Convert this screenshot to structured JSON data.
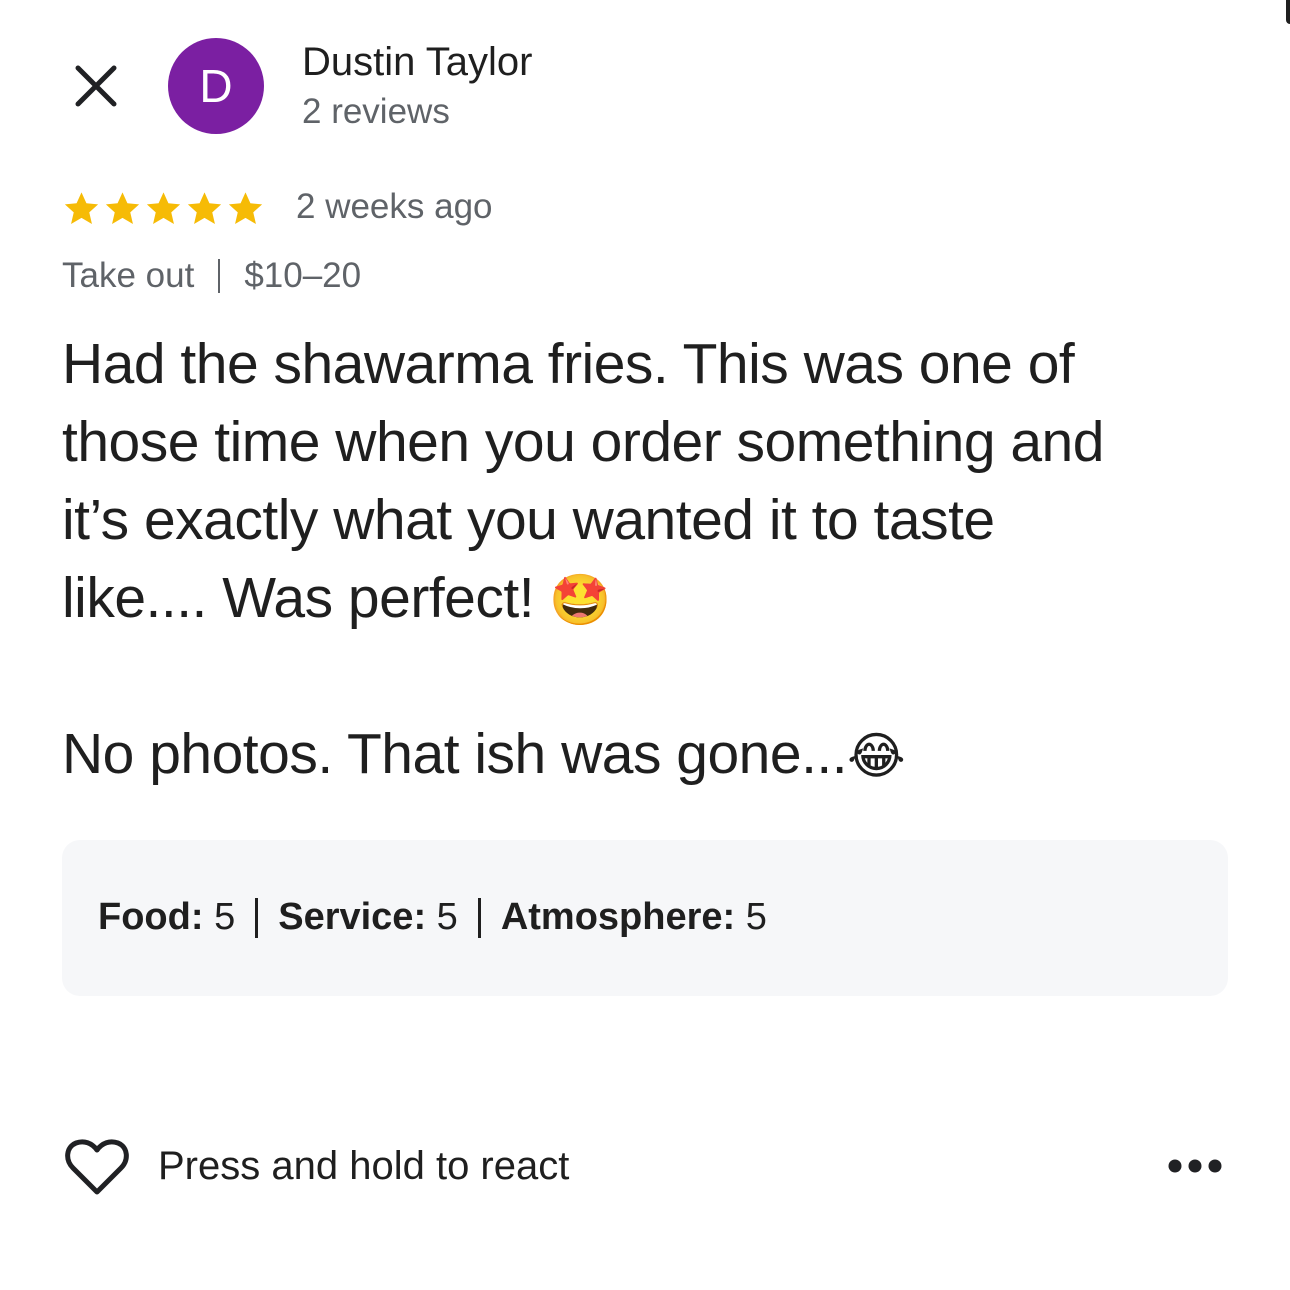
{
  "header": {
    "close_icon": "close-icon",
    "avatar_letter": "D",
    "avatar_color": "#7b1fa2",
    "author_name": "Dustin Taylor",
    "author_reviews": "2 reviews"
  },
  "review": {
    "rating": 5,
    "rating_max": 5,
    "star_color": "#f6bb06",
    "date": "2 weeks ago",
    "service_type": "Take out",
    "price_range": "$10–20",
    "text_lines": [
      "Had the shawarma fries. This was one of",
      "those time when you order something and",
      "it’s exactly what you wanted it to taste",
      "like.... Was perfect!"
    ],
    "emoji_1": "🤩",
    "second_paragraph": "No photos. That ish was gone...",
    "emoji_2": "😂"
  },
  "ratings": {
    "food_label": "Food:",
    "food_value": "5",
    "service_label": "Service:",
    "service_value": "5",
    "atmosphere_label": "Atmosphere:",
    "atmosphere_value": "5"
  },
  "footer": {
    "react_icon": "heart-outline-icon",
    "react_label": "Press and hold to react",
    "more_icon": "more-horizontal-icon"
  }
}
